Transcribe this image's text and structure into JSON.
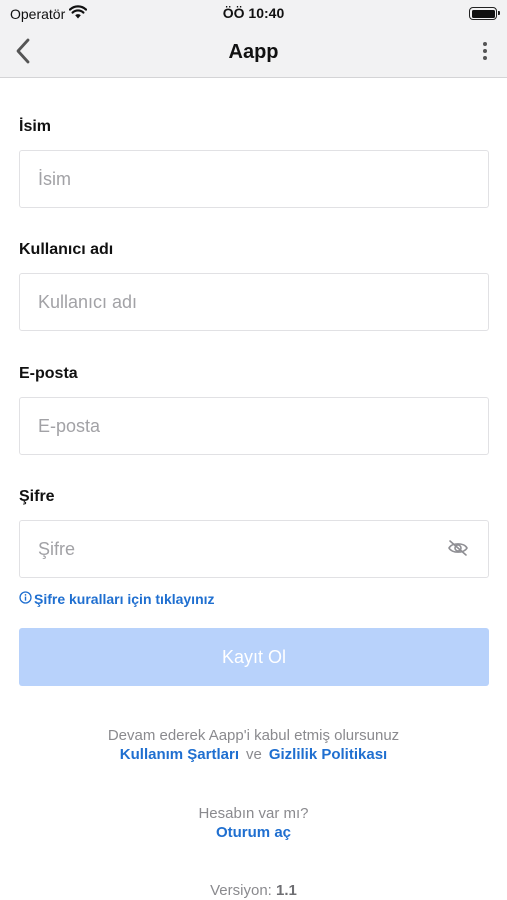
{
  "status_bar": {
    "carrier": "Operatör",
    "time": "ÖÖ 10:40",
    "icons": [
      "wifi-icon",
      "battery-icon"
    ]
  },
  "nav": {
    "title": "Aapp",
    "icons": [
      "chevron-left-icon",
      "more-vertical-icon"
    ]
  },
  "form": {
    "name": {
      "label": "İsim",
      "placeholder": "İsim",
      "value": ""
    },
    "username": {
      "label": "Kullanıcı adı",
      "placeholder": "Kullanıcı adı",
      "value": ""
    },
    "email": {
      "label": "E-posta",
      "placeholder": "E-posta",
      "value": ""
    },
    "password": {
      "label": "Şifre",
      "placeholder": "Şifre",
      "value": "",
      "toggle_icon": "eye-off-icon"
    },
    "rules_link": "Şifre kuralları için tıklayınız",
    "rules_icon": "info-icon",
    "submit_label": "Kayıt Ol",
    "submit_color": "#b8d2fb"
  },
  "footer": {
    "terms_text": "Devam ederek Aapp'i kabul etmiş olursunuz",
    "terms_link": "Kullanım Şartları",
    "and_text": "ve",
    "privacy_link": "Gizlilik Politikası",
    "have_account": "Hesabın var mı?",
    "login_link": "Oturum aç",
    "version_label": "Versiyon:",
    "version_value": "1.1"
  },
  "colors": {
    "accent": "#1f6fd0",
    "bar_background": "#f2f2f3",
    "muted_text": "#8a8a8e"
  }
}
